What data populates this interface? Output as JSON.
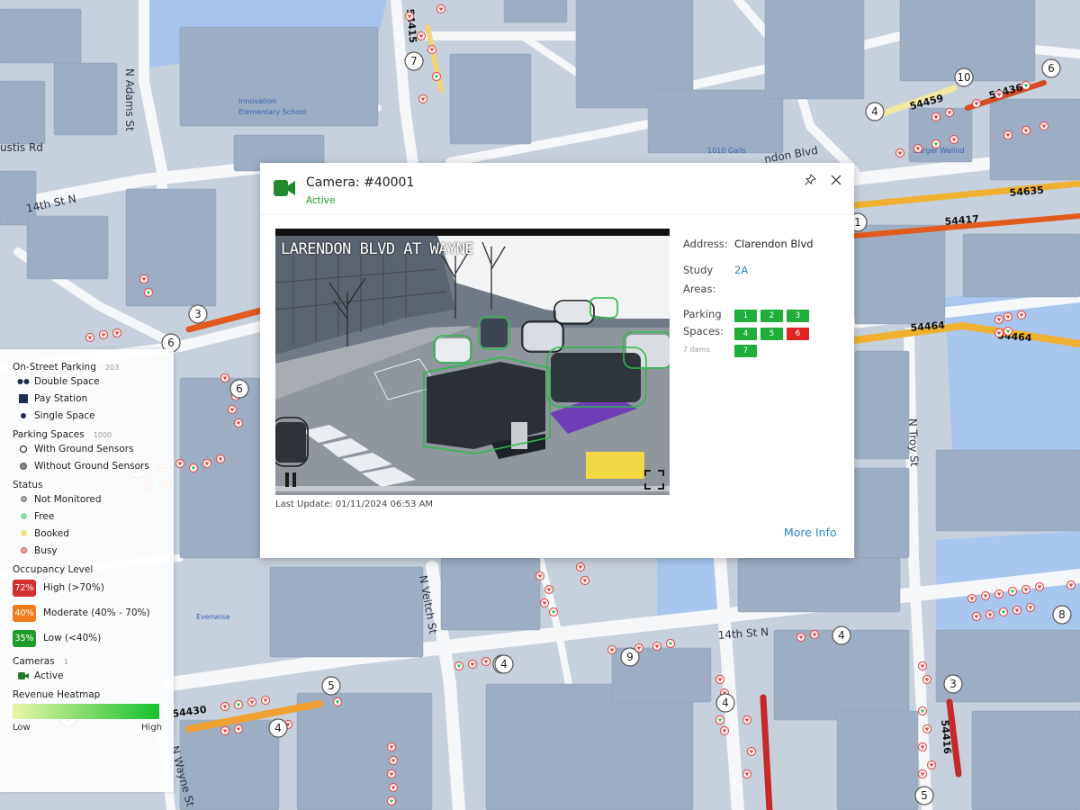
{
  "streets": {
    "adams": "N Adams St",
    "custis": "ustis Rd",
    "fourteenth_left": "14th St N",
    "fourteenth_right": "14th St N",
    "clarendon_right": "ndon Blvd",
    "troy": "N Troy St",
    "veitch": "N Veitch St",
    "wayne": "N Wayne St"
  },
  "pois": {
    "school": "Innovation Elementary School",
    "building1": "1010 Galls",
    "building2": "Burger Wellnd",
    "park": "Evenwise"
  },
  "segments": [
    "54459",
    "54436",
    "54635",
    "54417",
    "54464",
    "54464",
    "54430",
    "54416",
    "54415"
  ],
  "clusters": [
    "7",
    "10",
    "6",
    "4",
    "3",
    "6",
    "6",
    "1",
    "10",
    "4",
    "9",
    "4",
    "5",
    "4",
    "8",
    "4",
    "3",
    "5",
    "5",
    "4"
  ],
  "legend": {
    "on_street": {
      "title": "On-Street Parking",
      "count": "203",
      "items": [
        "Double Space",
        "Pay Station",
        "Single Space"
      ]
    },
    "parking_spaces": {
      "title": "Parking Spaces",
      "count": "1000",
      "items": [
        "With Ground Sensors",
        "Without Ground Sensors"
      ]
    },
    "status": {
      "title": "Status",
      "items": [
        "Not Monitored",
        "Free",
        "Booked",
        "Busy"
      ]
    },
    "occupancy": {
      "title": "Occupancy Level",
      "levels": [
        {
          "badge": "72%",
          "label": "High (>70%)",
          "color": "#d32f2f"
        },
        {
          "badge": "40%",
          "label": "Moderate (40% - 70%)",
          "color": "#ef7c1a"
        },
        {
          "badge": "35%",
          "label": "Low (<40%)",
          "color": "#1f9b2b"
        }
      ]
    },
    "cameras": {
      "title": "Cameras",
      "count": "1",
      "items": [
        "Active"
      ]
    },
    "revenue": {
      "title": "Revenue Heatmap",
      "low": "Low",
      "high": "High"
    }
  },
  "popup": {
    "title": "Camera: #40001",
    "status": "Active",
    "video_overlay": "LARENDON BLVD AT WAYNE",
    "last_update": "Last Update: 01/11/2024 06:53 AM",
    "address_label": "Address:",
    "address_value": "Clarendon Blvd",
    "study_label": "Study Areas:",
    "study_value": "2A",
    "spaces_label": "Parking Spaces:",
    "spaces_sub": "7 items",
    "spaces": [
      {
        "label": "1",
        "color": "#1fae3c"
      },
      {
        "label": "2",
        "color": "#1fae3c"
      },
      {
        "label": "3",
        "color": "#1fae3c"
      },
      {
        "label": "4",
        "color": "#1fae3c"
      },
      {
        "label": "5",
        "color": "#1fae3c"
      },
      {
        "label": "6",
        "color": "#e02424"
      },
      {
        "label": "7",
        "color": "#1fae3c"
      }
    ],
    "more_info": "More Info"
  },
  "colors": {
    "accent": "#2e86c9",
    "active_green": "#1f9b2b",
    "busy_red": "#e02424",
    "high": "#d32f2f",
    "moderate": "#ef7c1a",
    "low": "#1f9b2b"
  },
  "icons": {
    "camera": "video-camera-icon",
    "pin": "pin-icon",
    "close": "close-icon",
    "pause": "pause-icon",
    "fullscreen": "fullscreen-icon"
  }
}
